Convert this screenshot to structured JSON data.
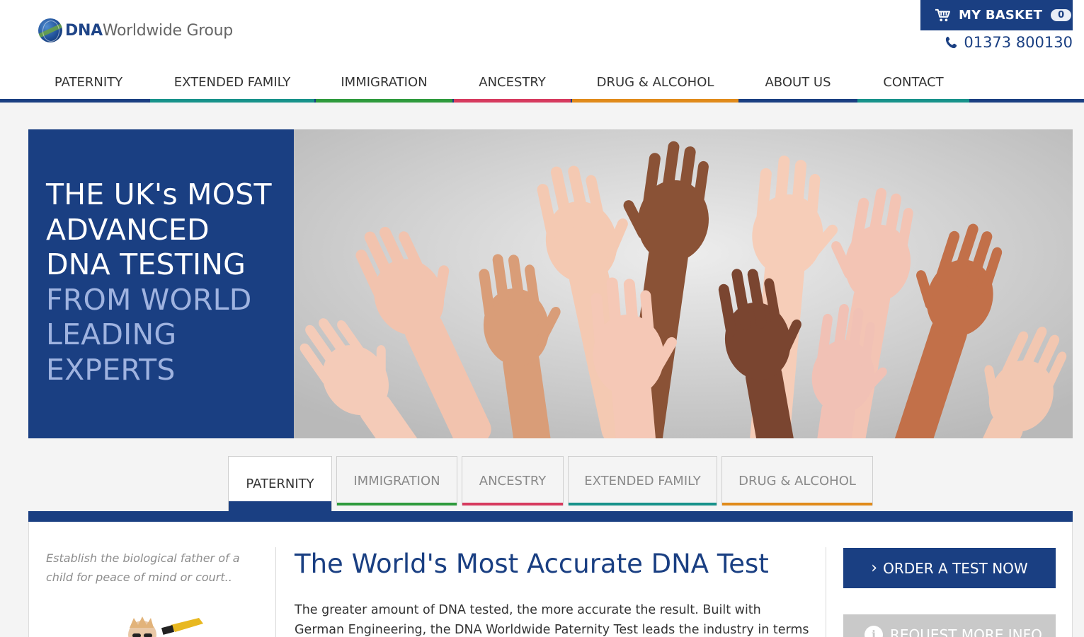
{
  "logo": {
    "bold": "DNA",
    "rest": "Worldwide Group"
  },
  "basket": {
    "label": "MY BASKET",
    "count": "0"
  },
  "phone": "01373 800130",
  "nav": [
    {
      "label": "PATERNITY",
      "color": "#1a3f82"
    },
    {
      "label": "EXTENDED FAMILY",
      "color": "#17928a"
    },
    {
      "label": "IMMIGRATION",
      "color": "#2e9a3c"
    },
    {
      "label": "ANCESTRY",
      "color": "#d63a5e"
    },
    {
      "label": "DRUG & ALCOHOL",
      "color": "#e08a1a"
    },
    {
      "label": "ABOUT US",
      "color": "#1a3f82"
    },
    {
      "label": "CONTACT",
      "color": "#17928a"
    }
  ],
  "hero": {
    "lines": [
      "THE UK's MOST",
      "ADVANCED",
      "DNA TESTING"
    ],
    "light_lines": [
      "FROM WORLD",
      "LEADING",
      "EXPERTS"
    ]
  },
  "tabs": [
    {
      "label": "PATERNITY",
      "color": "#1a3f82",
      "active": true
    },
    {
      "label": "IMMIGRATION",
      "color": "#2e9a3c"
    },
    {
      "label": "ANCESTRY",
      "color": "#d63a5e"
    },
    {
      "label": "EXTENDED FAMILY",
      "color": "#17928a"
    },
    {
      "label": "DRUG & ALCOHOL",
      "color": "#e08a1a"
    }
  ],
  "content": {
    "intro": "Establish the biological father of a child for peace of mind or court..",
    "headline": "The World's Most Accurate DNA Test",
    "body": "The greater amount of DNA tested, the more accurate the result. Built with German Engineering, the DNA Worldwide Paternity Test leads the industry in terms of",
    "order_button": "ORDER A TEST NOW",
    "info_button": "REQUEST MORE INFO"
  },
  "colors": {
    "brand": "#1a3f82",
    "hero_accent": "#9fb3e0"
  }
}
